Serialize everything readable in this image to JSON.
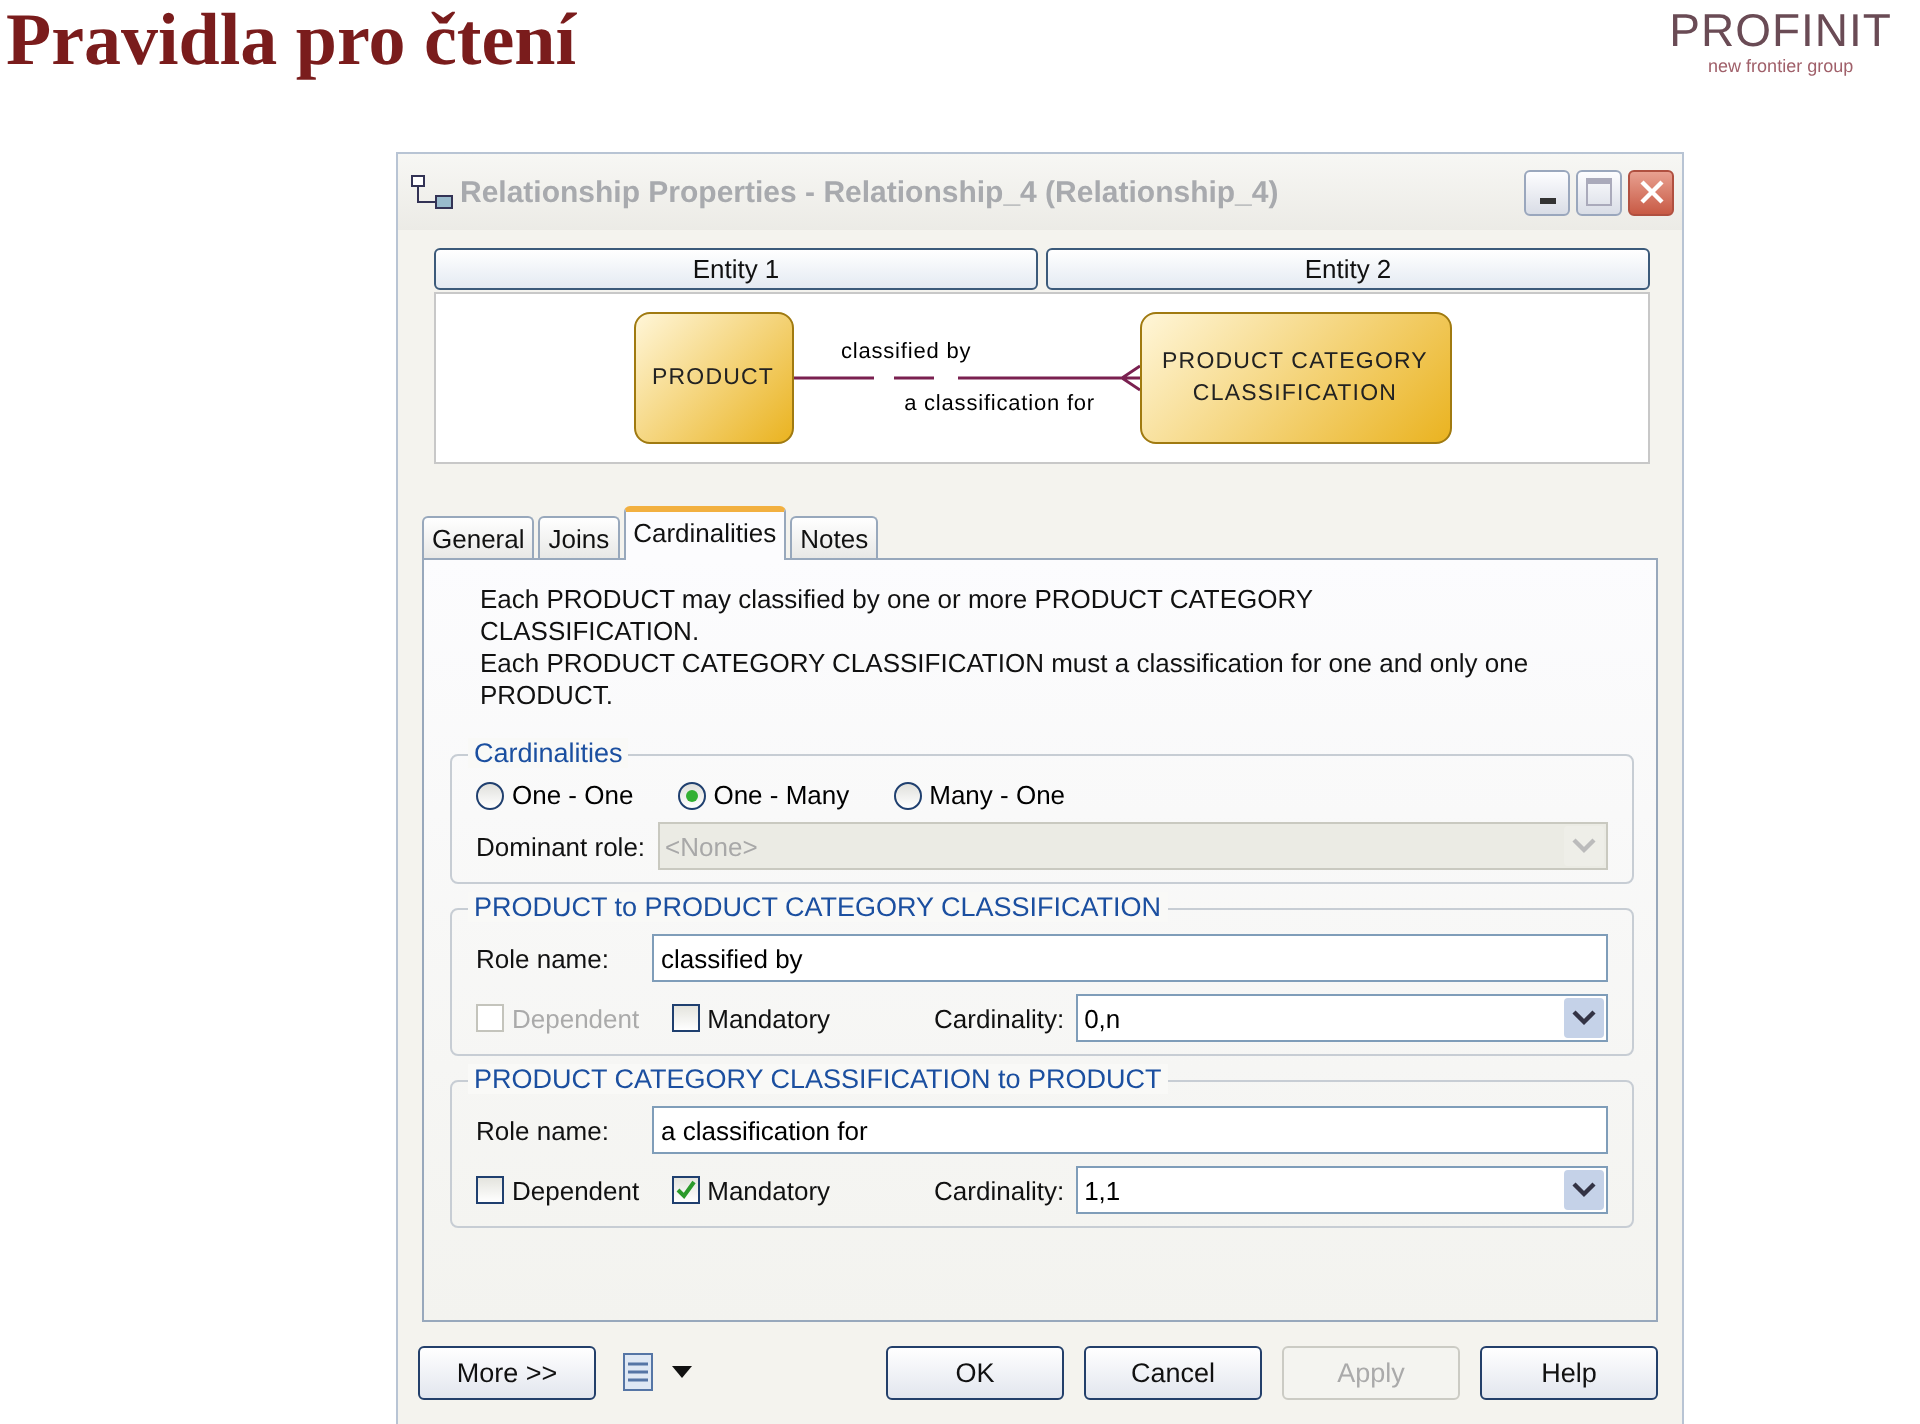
{
  "slide": {
    "title": "Pravidla pro čtení",
    "logo": {
      "name": "PROFINIT",
      "tagline": "new frontier group"
    }
  },
  "window": {
    "title": "Relationship Properties - Relationship_4 (Relationship_4)"
  },
  "entity_buttons": [
    "Entity 1",
    "Entity 2"
  ],
  "diagram": {
    "entities": [
      {
        "label": "PRODUCT"
      },
      {
        "label": "PRODUCT CATEGORY\nCLASSIFICATION"
      }
    ],
    "role_1": "classified by",
    "role_2": "a classification for"
  },
  "tabs": [
    {
      "label": "General",
      "selected": false
    },
    {
      "label": "Joins",
      "selected": false
    },
    {
      "label": "Cardinalities",
      "selected": true
    },
    {
      "label": "Notes",
      "selected": false
    }
  ],
  "description": "Each PRODUCT may classified by one or more PRODUCT CATEGORY CLASSIFICATION.\nEach PRODUCT CATEGORY CLASSIFICATION must a classification for one and only one PRODUCT.",
  "cardinalities": {
    "legend": "Cardinalities",
    "options": [
      {
        "label": "One - One",
        "selected": false
      },
      {
        "label": "One - Many",
        "selected": true
      },
      {
        "label": "Many - One",
        "selected": false
      }
    ],
    "dominant_role": {
      "label": "Dominant role:",
      "value": "<None>",
      "disabled": true
    }
  },
  "roles": [
    {
      "title": "PRODUCT to PRODUCT CATEGORY CLASSIFICATION",
      "role_name_label": "Role name:",
      "role_name": "classified by",
      "dependent": {
        "label": "Dependent",
        "checked": false,
        "disabled": true
      },
      "mandatory": {
        "label": "Mandatory",
        "checked": false,
        "disabled": false
      },
      "cardinality_label": "Cardinality:",
      "cardinality": "0,n"
    },
    {
      "title": "PRODUCT CATEGORY CLASSIFICATION to PRODUCT",
      "role_name_label": "Role name:",
      "role_name": "a classification for",
      "dependent": {
        "label": "Dependent",
        "checked": false,
        "disabled": false
      },
      "mandatory": {
        "label": "Mandatory",
        "checked": true,
        "disabled": false
      },
      "cardinality_label": "Cardinality:",
      "cardinality": "1,1"
    }
  ],
  "more_button": "More >>",
  "buttons": [
    {
      "label": "OK",
      "disabled": false
    },
    {
      "label": "Cancel",
      "disabled": false
    },
    {
      "label": "Apply",
      "disabled": true
    },
    {
      "label": "Help",
      "disabled": false
    }
  ]
}
